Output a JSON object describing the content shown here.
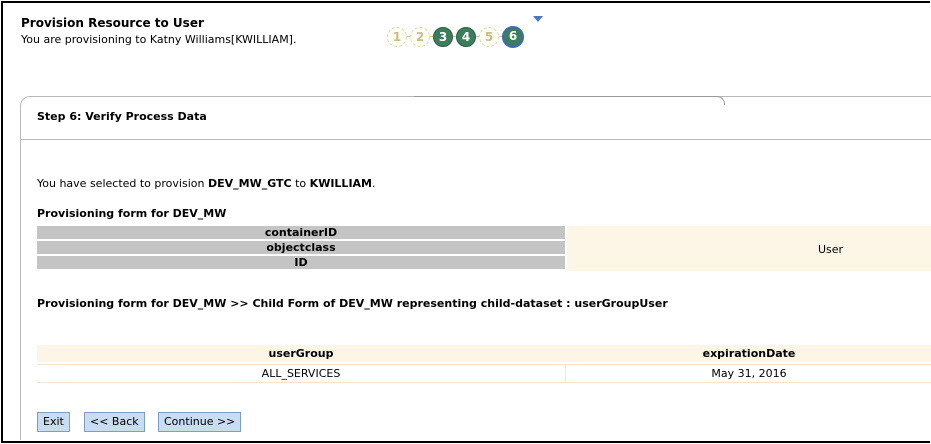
{
  "header": {
    "title": "Provision Resource to User",
    "subtitle": "You are provisioning to Katny Williams[KWILLIAM]."
  },
  "wizard": {
    "steps": [
      "1",
      "2",
      "3",
      "4",
      "5",
      "6"
    ],
    "current_step": 6
  },
  "step_heading": "Step 6: Verify Process Data",
  "summary": {
    "prefix": "You have selected to provision ",
    "resource": "DEV_MW_GTC",
    "middle": " to ",
    "user": "KWILLIAM",
    "suffix": "."
  },
  "form1": {
    "title": "Provisioning form for DEV_MW",
    "labels": [
      "containerID",
      "objectclass",
      "ID"
    ],
    "value": "User"
  },
  "form2": {
    "title": "Provisioning form for DEV_MW >> Child Form of DEV_MW representing child-dataset : userGroupUser",
    "columns": [
      "userGroup",
      "expirationDate"
    ],
    "rows": [
      [
        "ALL_SERVICES",
        "May 31, 2016"
      ]
    ]
  },
  "buttons": {
    "exit": "Exit",
    "back": "<< Back",
    "continue": "Continue >>"
  },
  "colors": {
    "step_active": "#3c7d5b",
    "step_current_ring": "#3a6ab8",
    "label_bg": "#c4c4c4",
    "value_bg": "#fdf6e6",
    "button_bg": "#c8dcf2"
  }
}
